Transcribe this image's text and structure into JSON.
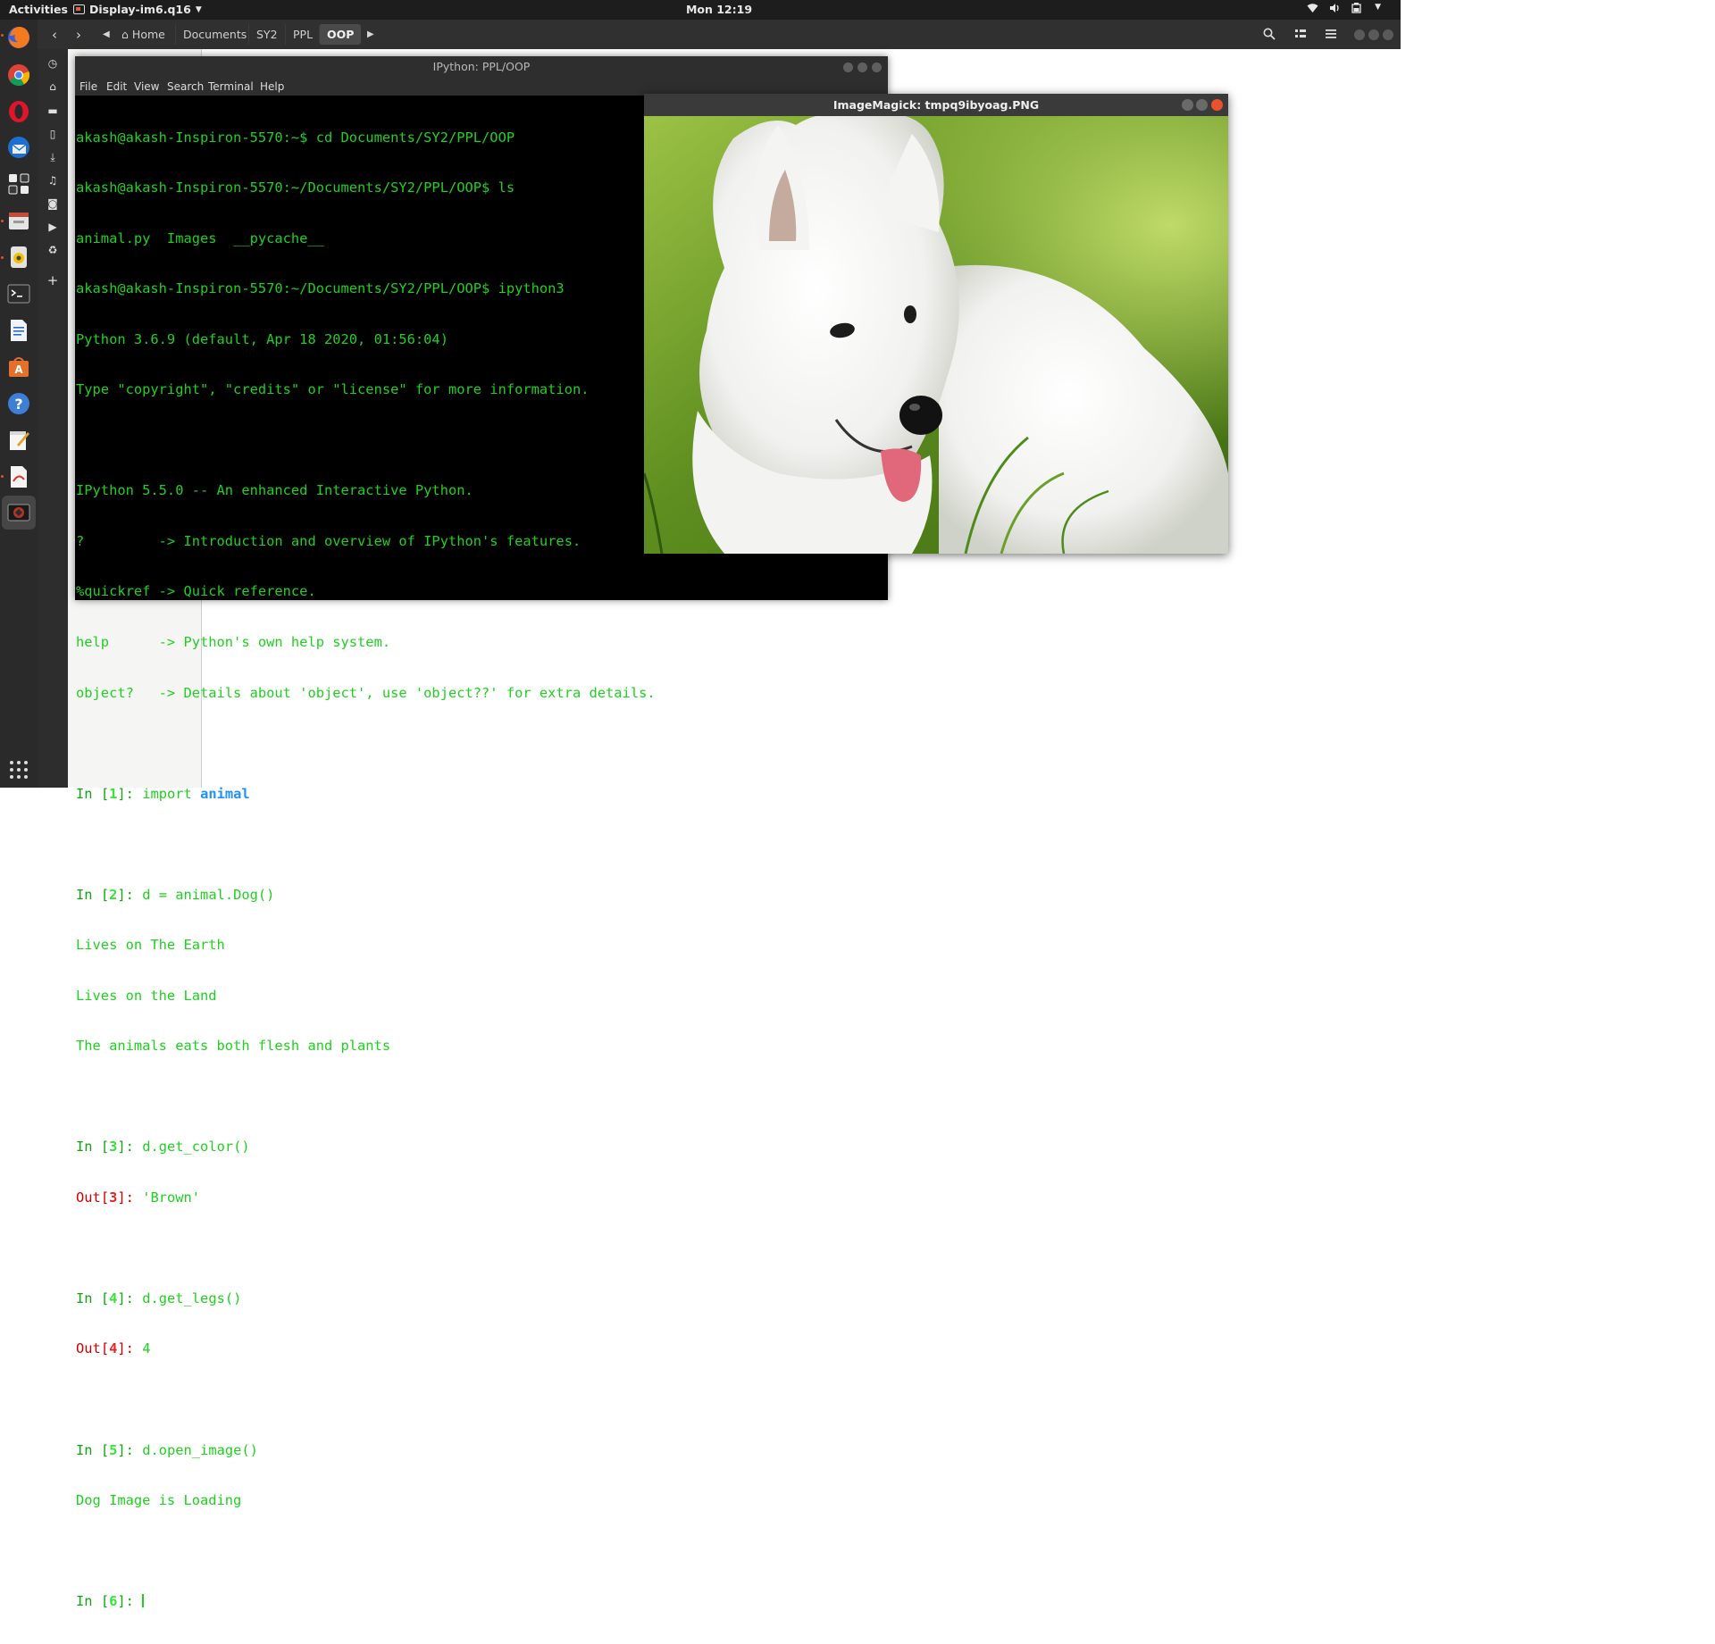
{
  "topbar": {
    "activities": "Activities",
    "app_name": "Display-im6.q16",
    "clock": "Mon 12:19"
  },
  "filemanager": {
    "breadcrumbs": [
      {
        "label": "Home"
      },
      {
        "label": "Documents"
      },
      {
        "label": "SY2"
      },
      {
        "label": "PPL"
      },
      {
        "label": "OOP"
      }
    ]
  },
  "terminal": {
    "title": "IPython: PPL/OOP",
    "menu": [
      "File",
      "Edit",
      "View",
      "Search",
      "Terminal",
      "Help"
    ],
    "lines": {
      "l1": "akash@akash-Inspiron-5570:~$ cd Documents/SY2/PPL/OOP",
      "l2": "akash@akash-Inspiron-5570:~/Documents/SY2/PPL/OOP$ ls",
      "l3": "animal.py  Images  __pycache__",
      "l4": "akash@akash-Inspiron-5570:~/Documents/SY2/PPL/OOP$ ipython3",
      "l5": "Python 3.6.9 (default, Apr 18 2020, 01:56:04)",
      "l6": "Type \"copyright\", \"credits\" or \"license\" for more information.",
      "l7": "IPython 5.5.0 -- An enhanced Interactive Python.",
      "l8": "?         -> Introduction and overview of IPython's features.",
      "l9": "%quickref -> Quick reference.",
      "l10": "help      -> Python's own help system.",
      "l11": "object?   -> Details about 'object', use 'object??' for extra details.",
      "in1_code": "import ",
      "in1_mod": "animal",
      "in2_code": "d = animal.Dog()",
      "o2a": "Lives on The Earth",
      "o2b": "Lives on the Land",
      "o2c": "The animals eats both flesh and plants",
      "in3_code": "d.get_color()",
      "out3": "'Brown'",
      "in4_code": "d.get_legs()",
      "out4": "4",
      "in5_code": "d.open_image()",
      "o5": "Dog Image is Loading",
      "in_label": "In ",
      "out_label": "Out",
      "n1": "1",
      "n2": "2",
      "n3": "3",
      "n4": "4",
      "n5": "5",
      "n6": "6"
    }
  },
  "imagemagick": {
    "title": "ImageMagick: tmpq9ibyoag.PNG"
  }
}
